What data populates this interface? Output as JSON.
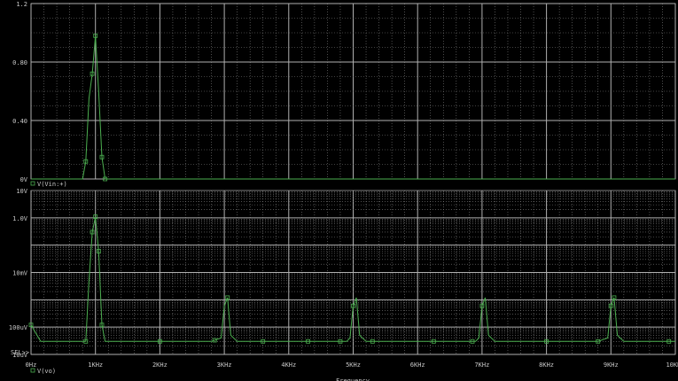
{
  "colors": {
    "background": "#000000",
    "grid": "#808080",
    "gridBold": "#b0b0b0",
    "trace": "#4caf50",
    "text": "#c8c8c8"
  },
  "x_tick_labels": [
    "0Hz",
    "1KHz",
    "2KHz",
    "3KHz",
    "4KHz",
    "5KHz",
    "6KHz",
    "7KHz",
    "8KHz",
    "9KHz",
    "10KHz"
  ],
  "x_axis_label": "Frequency",
  "sel_marker": "SEL>>",
  "chart_data": [
    {
      "type": "line",
      "name": "top-plot",
      "x_unit": "Hz",
      "xlim": [
        0,
        10000
      ],
      "ylim": [
        0,
        1.2
      ],
      "y_scale": "linear",
      "y_tick_labels": [
        "0V",
        "0.40",
        "0.80",
        "1.2"
      ],
      "y_ticks": [
        0,
        0.4,
        0.8,
        1.2
      ],
      "grid": true,
      "legend": "bottom-left",
      "series": [
        {
          "name": "V(Vin:+)",
          "x": [
            0,
            200,
            400,
            600,
            800,
            850,
            900,
            950,
            1000,
            1050,
            1100,
            1150,
            1200,
            1400,
            2000,
            3000,
            4000,
            5000,
            6000,
            7000,
            8000,
            9000,
            10000
          ],
          "y": [
            0,
            0,
            0,
            0,
            0,
            0.12,
            0.55,
            0.72,
            0.98,
            0.6,
            0.15,
            0,
            0,
            0,
            0,
            0,
            0,
            0,
            0,
            0,
            0,
            0,
            0
          ],
          "markers_x": [
            850,
            950,
            1000,
            1100,
            1150
          ]
        }
      ]
    },
    {
      "type": "line",
      "name": "bottom-plot",
      "x_unit": "Hz",
      "xlim": [
        0,
        10000
      ],
      "ylim": [
        1e-05,
        10
      ],
      "y_scale": "log",
      "y_tick_labels": [
        "10uV",
        "100uV",
        "10mV",
        "1.0V",
        "10V"
      ],
      "y_ticks": [
        1e-05,
        0.0001,
        0.01,
        1,
        10
      ],
      "grid": true,
      "legend": "bottom-left",
      "series": [
        {
          "name": "V(vo)",
          "x": [
            0,
            150,
            800,
            850,
            900,
            950,
            1000,
            1050,
            1100,
            1150,
            1200,
            1900,
            2800,
            2950,
            3000,
            3050,
            3100,
            3200,
            3900,
            4900,
            4950,
            5000,
            5050,
            5100,
            5200,
            6900,
            6950,
            7000,
            7050,
            7100,
            7200,
            8800,
            8950,
            9000,
            9050,
            9100,
            9200,
            10000
          ],
          "y": [
            0.00012,
            3e-05,
            3e-05,
            3e-05,
            0.005,
            0.3,
            1.1,
            0.06,
            0.00012,
            3e-05,
            3e-05,
            3e-05,
            3e-05,
            4e-05,
            0.0006,
            0.0012,
            5e-05,
            3e-05,
            3e-05,
            3e-05,
            4e-05,
            0.0006,
            0.0012,
            5e-05,
            3e-05,
            3e-05,
            4e-05,
            0.0006,
            0.0012,
            5e-05,
            3e-05,
            3e-05,
            4e-05,
            0.0006,
            0.0012,
            5e-05,
            3e-05,
            3e-05
          ],
          "markers_x": [
            0,
            850,
            950,
            1000,
            1050,
            1100,
            2000,
            2850,
            3050,
            3600,
            4300,
            4800,
            5000,
            5300,
            6250,
            6850,
            7000,
            8000,
            8800,
            9000,
            9050,
            9900
          ]
        }
      ]
    }
  ]
}
